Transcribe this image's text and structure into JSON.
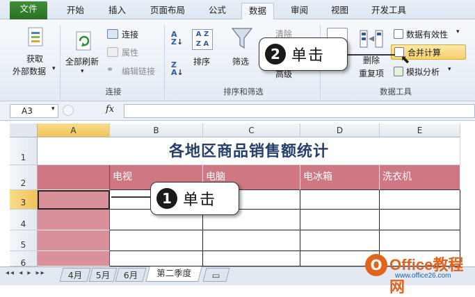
{
  "ribbon": {
    "tabs": [
      "文件",
      "开始",
      "插入",
      "页面布局",
      "公式",
      "数据",
      "审阅",
      "视图",
      "开发工具"
    ],
    "active_tab": "数据",
    "groups": {
      "external": {
        "label_line1": "获取",
        "label_line2": "外部数据"
      },
      "connections": {
        "label": "连接",
        "refresh_all": "全部刷新",
        "connections": "连接",
        "properties": "属性",
        "edit_links": "编辑链接"
      },
      "sort_filter": {
        "label": "排序和筛选",
        "sort": "排序",
        "filter": "筛选",
        "clear": "清除",
        "advanced": "高级"
      },
      "data_tools": {
        "label": "数据工具",
        "remove_dup_line1": "删除",
        "remove_dup_line2": "重复项",
        "data_validation": "数据有效性",
        "consolidate": "合并计算",
        "what_if": "模拟分析"
      }
    }
  },
  "formula_bar": {
    "name_box": "A3",
    "fx": "fx",
    "value": ""
  },
  "sheet": {
    "columns": [
      "A",
      "B",
      "C",
      "D",
      "E"
    ],
    "rows": [
      "1",
      "2",
      "3",
      "4",
      "5",
      "6"
    ],
    "title": "各地区商品销售额统计",
    "headers": [
      "电视",
      "电脑",
      "电冰箱",
      "洗衣机"
    ]
  },
  "sheet_tabs": [
    "4月",
    "5月",
    "6月",
    "第二季度"
  ],
  "active_sheet": "第二季度",
  "callouts": [
    {
      "number": "1",
      "text": "单击"
    },
    {
      "number": "2",
      "text": "单击"
    }
  ],
  "watermark": {
    "brand": "Office教程网",
    "url": "www.office26.com"
  },
  "colors": {
    "header_pink": "#cf7782",
    "title_blue": "#24406b",
    "selected_header": "#f1c25a"
  }
}
